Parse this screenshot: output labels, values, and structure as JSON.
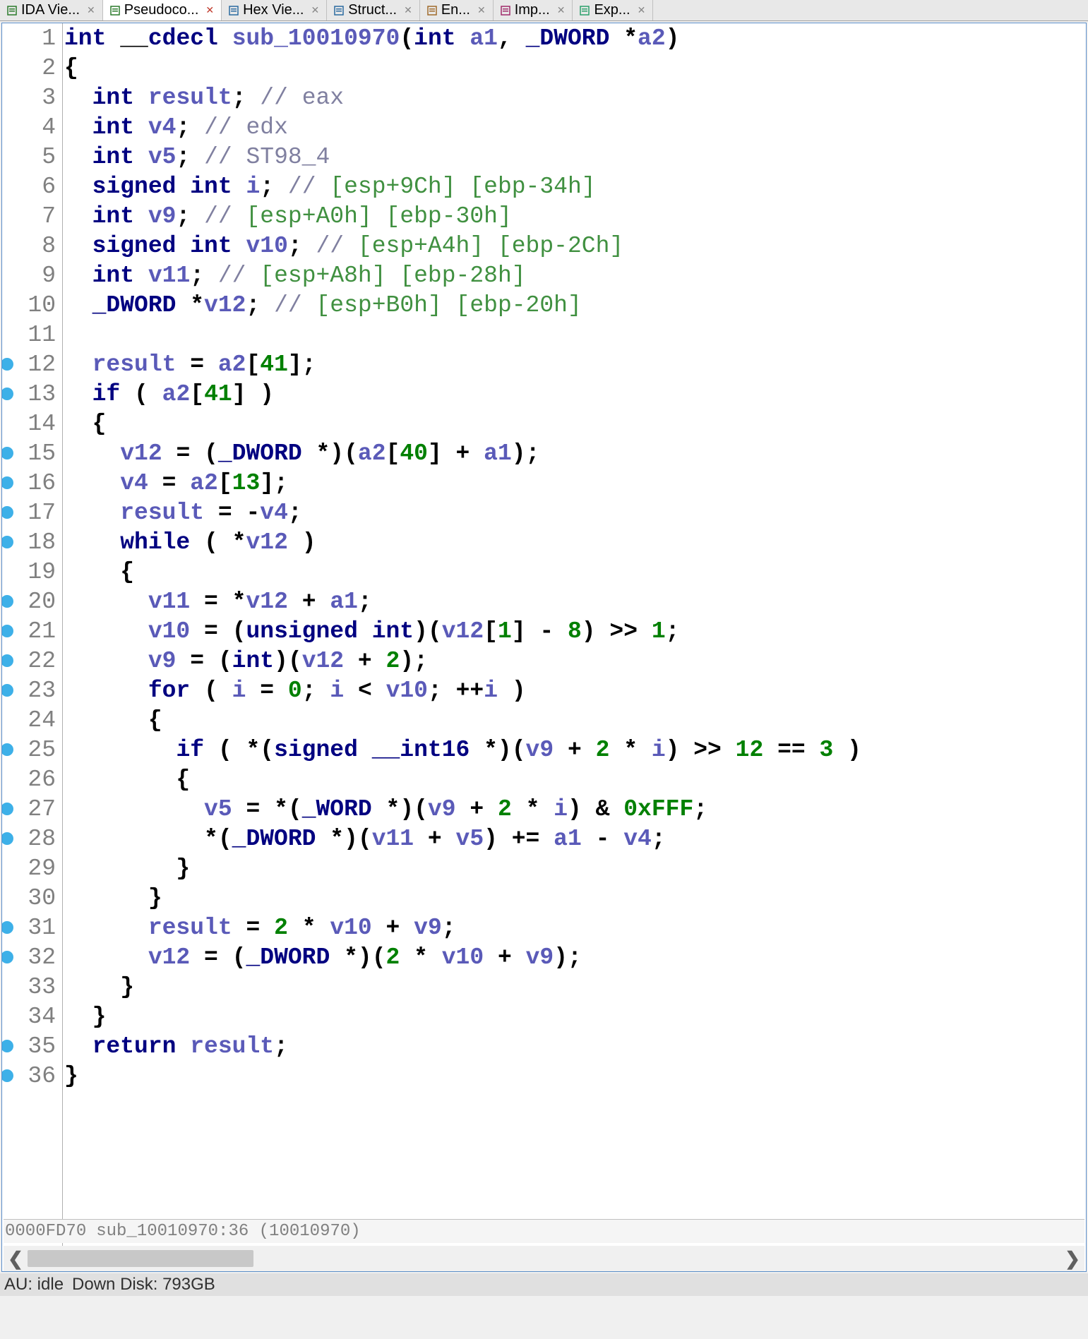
{
  "tabs": [
    {
      "label": "IDA Vie...",
      "icon": "code-icon",
      "close": "grey"
    },
    {
      "label": "Pseudoco...",
      "icon": "code-icon",
      "close": "red",
      "active": true
    },
    {
      "label": "Hex Vie...",
      "icon": "hex-icon",
      "close": "grey"
    },
    {
      "label": "Struct...",
      "icon": "struct-icon",
      "close": "grey"
    },
    {
      "label": "En...",
      "icon": "enum-icon",
      "close": "grey"
    },
    {
      "label": "Imp...",
      "icon": "import-icon",
      "close": "grey"
    },
    {
      "label": "Exp...",
      "icon": "export-icon",
      "close": "grey"
    }
  ],
  "lines": [
    {
      "n": 1,
      "bp": false,
      "tokens": [
        [
          "kw",
          "int"
        ],
        [
          "op",
          " __"
        ],
        [
          "kw",
          "cdecl"
        ],
        [
          "op",
          " "
        ],
        [
          "id",
          "sub_10010970"
        ],
        [
          "op",
          "("
        ],
        [
          "kw",
          "int"
        ],
        [
          "op",
          " "
        ],
        [
          "id",
          "a1"
        ],
        [
          "op",
          ", "
        ],
        [
          "kw",
          "_DWORD"
        ],
        [
          "op",
          " *"
        ],
        [
          "id",
          "a2"
        ],
        [
          "op",
          ")"
        ]
      ]
    },
    {
      "n": 2,
      "bp": false,
      "tokens": [
        [
          "op",
          "{"
        ]
      ]
    },
    {
      "n": 3,
      "bp": false,
      "tokens": [
        [
          "op",
          "  "
        ],
        [
          "kw",
          "int"
        ],
        [
          "op",
          " "
        ],
        [
          "id",
          "result"
        ],
        [
          "op",
          "; "
        ],
        [
          "com",
          "// eax"
        ]
      ]
    },
    {
      "n": 4,
      "bp": false,
      "tokens": [
        [
          "op",
          "  "
        ],
        [
          "kw",
          "int"
        ],
        [
          "op",
          " "
        ],
        [
          "id",
          "v4"
        ],
        [
          "op",
          "; "
        ],
        [
          "com",
          "// edx"
        ]
      ]
    },
    {
      "n": 5,
      "bp": false,
      "tokens": [
        [
          "op",
          "  "
        ],
        [
          "kw",
          "int"
        ],
        [
          "op",
          " "
        ],
        [
          "id",
          "v5"
        ],
        [
          "op",
          "; "
        ],
        [
          "com",
          "// ST98_4"
        ]
      ]
    },
    {
      "n": 6,
      "bp": false,
      "tokens": [
        [
          "op",
          "  "
        ],
        [
          "kw",
          "signed int"
        ],
        [
          "op",
          " "
        ],
        [
          "id",
          "i"
        ],
        [
          "op",
          "; "
        ],
        [
          "com",
          "// "
        ],
        [
          "comg",
          "[esp+9Ch] [ebp-34h]"
        ]
      ]
    },
    {
      "n": 7,
      "bp": false,
      "tokens": [
        [
          "op",
          "  "
        ],
        [
          "kw",
          "int"
        ],
        [
          "op",
          " "
        ],
        [
          "id",
          "v9"
        ],
        [
          "op",
          "; "
        ],
        [
          "com",
          "// "
        ],
        [
          "comg",
          "[esp+A0h] [ebp-30h]"
        ]
      ]
    },
    {
      "n": 8,
      "bp": false,
      "tokens": [
        [
          "op",
          "  "
        ],
        [
          "kw",
          "signed int"
        ],
        [
          "op",
          " "
        ],
        [
          "id",
          "v10"
        ],
        [
          "op",
          "; "
        ],
        [
          "com",
          "// "
        ],
        [
          "comg",
          "[esp+A4h] [ebp-2Ch]"
        ]
      ]
    },
    {
      "n": 9,
      "bp": false,
      "tokens": [
        [
          "op",
          "  "
        ],
        [
          "kw",
          "int"
        ],
        [
          "op",
          " "
        ],
        [
          "id",
          "v11"
        ],
        [
          "op",
          "; "
        ],
        [
          "com",
          "// "
        ],
        [
          "comg",
          "[esp+A8h] [ebp-28h]"
        ]
      ]
    },
    {
      "n": 10,
      "bp": false,
      "tokens": [
        [
          "op",
          "  "
        ],
        [
          "kw",
          "_DWORD"
        ],
        [
          "op",
          " *"
        ],
        [
          "id",
          "v12"
        ],
        [
          "op",
          "; "
        ],
        [
          "com",
          "// "
        ],
        [
          "comg",
          "[esp+B0h] [ebp-20h]"
        ]
      ]
    },
    {
      "n": 11,
      "bp": false,
      "tokens": [
        [
          "op",
          ""
        ]
      ]
    },
    {
      "n": 12,
      "bp": true,
      "tokens": [
        [
          "op",
          "  "
        ],
        [
          "id",
          "result"
        ],
        [
          "op",
          " = "
        ],
        [
          "id",
          "a2"
        ],
        [
          "op",
          "["
        ],
        [
          "num",
          "41"
        ],
        [
          "op",
          "];"
        ]
      ]
    },
    {
      "n": 13,
      "bp": true,
      "tokens": [
        [
          "op",
          "  "
        ],
        [
          "kw",
          "if"
        ],
        [
          "op",
          " ( "
        ],
        [
          "id",
          "a2"
        ],
        [
          "op",
          "["
        ],
        [
          "num",
          "41"
        ],
        [
          "op",
          "] )"
        ]
      ]
    },
    {
      "n": 14,
      "bp": false,
      "tokens": [
        [
          "op",
          "  {"
        ]
      ]
    },
    {
      "n": 15,
      "bp": true,
      "tokens": [
        [
          "op",
          "    "
        ],
        [
          "id",
          "v12"
        ],
        [
          "op",
          " = ("
        ],
        [
          "kw",
          "_DWORD"
        ],
        [
          "op",
          " *)("
        ],
        [
          "id",
          "a2"
        ],
        [
          "op",
          "["
        ],
        [
          "num",
          "40"
        ],
        [
          "op",
          "] + "
        ],
        [
          "id",
          "a1"
        ],
        [
          "op",
          ");"
        ]
      ]
    },
    {
      "n": 16,
      "bp": true,
      "tokens": [
        [
          "op",
          "    "
        ],
        [
          "id",
          "v4"
        ],
        [
          "op",
          " = "
        ],
        [
          "id",
          "a2"
        ],
        [
          "op",
          "["
        ],
        [
          "num",
          "13"
        ],
        [
          "op",
          "];"
        ]
      ]
    },
    {
      "n": 17,
      "bp": true,
      "tokens": [
        [
          "op",
          "    "
        ],
        [
          "id",
          "result"
        ],
        [
          "op",
          " = -"
        ],
        [
          "id",
          "v4"
        ],
        [
          "op",
          ";"
        ]
      ]
    },
    {
      "n": 18,
      "bp": true,
      "tokens": [
        [
          "op",
          "    "
        ],
        [
          "kw",
          "while"
        ],
        [
          "op",
          " ( *"
        ],
        [
          "id",
          "v12"
        ],
        [
          "op",
          " )"
        ]
      ]
    },
    {
      "n": 19,
      "bp": false,
      "tokens": [
        [
          "op",
          "    {"
        ]
      ]
    },
    {
      "n": 20,
      "bp": true,
      "tokens": [
        [
          "op",
          "      "
        ],
        [
          "id",
          "v11"
        ],
        [
          "op",
          " = *"
        ],
        [
          "id",
          "v12"
        ],
        [
          "op",
          " + "
        ],
        [
          "id",
          "a1"
        ],
        [
          "op",
          ";"
        ]
      ]
    },
    {
      "n": 21,
      "bp": true,
      "tokens": [
        [
          "op",
          "      "
        ],
        [
          "id",
          "v10"
        ],
        [
          "op",
          " = ("
        ],
        [
          "kw",
          "unsigned int"
        ],
        [
          "op",
          ")("
        ],
        [
          "id",
          "v12"
        ],
        [
          "op",
          "["
        ],
        [
          "num",
          "1"
        ],
        [
          "op",
          "] - "
        ],
        [
          "num",
          "8"
        ],
        [
          "op",
          ") >> "
        ],
        [
          "num",
          "1"
        ],
        [
          "op",
          ";"
        ]
      ]
    },
    {
      "n": 22,
      "bp": true,
      "tokens": [
        [
          "op",
          "      "
        ],
        [
          "id",
          "v9"
        ],
        [
          "op",
          " = ("
        ],
        [
          "kw",
          "int"
        ],
        [
          "op",
          ")("
        ],
        [
          "id",
          "v12"
        ],
        [
          "op",
          " + "
        ],
        [
          "num",
          "2"
        ],
        [
          "op",
          ");"
        ]
      ]
    },
    {
      "n": 23,
      "bp": true,
      "tokens": [
        [
          "op",
          "      "
        ],
        [
          "kw",
          "for"
        ],
        [
          "op",
          " ( "
        ],
        [
          "id",
          "i"
        ],
        [
          "op",
          " = "
        ],
        [
          "num",
          "0"
        ],
        [
          "op",
          "; "
        ],
        [
          "id",
          "i"
        ],
        [
          "op",
          " < "
        ],
        [
          "id",
          "v10"
        ],
        [
          "op",
          "; ++"
        ],
        [
          "id",
          "i"
        ],
        [
          "op",
          " )"
        ]
      ]
    },
    {
      "n": 24,
      "bp": false,
      "tokens": [
        [
          "op",
          "      {"
        ]
      ]
    },
    {
      "n": 25,
      "bp": true,
      "tokens": [
        [
          "op",
          "        "
        ],
        [
          "kw",
          "if"
        ],
        [
          "op",
          " ( *("
        ],
        [
          "kw",
          "signed __int16"
        ],
        [
          "op",
          " *)("
        ],
        [
          "id",
          "v9"
        ],
        [
          "op",
          " + "
        ],
        [
          "num",
          "2"
        ],
        [
          "op",
          " * "
        ],
        [
          "id",
          "i"
        ],
        [
          "op",
          ") >> "
        ],
        [
          "num",
          "12"
        ],
        [
          "op",
          " == "
        ],
        [
          "num",
          "3"
        ],
        [
          "op",
          " )"
        ]
      ]
    },
    {
      "n": 26,
      "bp": false,
      "tokens": [
        [
          "op",
          "        {"
        ]
      ]
    },
    {
      "n": 27,
      "bp": true,
      "tokens": [
        [
          "op",
          "          "
        ],
        [
          "id",
          "v5"
        ],
        [
          "op",
          " = *("
        ],
        [
          "kw",
          "_WORD"
        ],
        [
          "op",
          " *)("
        ],
        [
          "id",
          "v9"
        ],
        [
          "op",
          " + "
        ],
        [
          "num",
          "2"
        ],
        [
          "op",
          " * "
        ],
        [
          "id",
          "i"
        ],
        [
          "op",
          ") & "
        ],
        [
          "num",
          "0xFFF"
        ],
        [
          "op",
          ";"
        ]
      ]
    },
    {
      "n": 28,
      "bp": true,
      "tokens": [
        [
          "op",
          "          *("
        ],
        [
          "kw",
          "_DWORD"
        ],
        [
          "op",
          " *)("
        ],
        [
          "id",
          "v11"
        ],
        [
          "op",
          " + "
        ],
        [
          "id",
          "v5"
        ],
        [
          "op",
          ") += "
        ],
        [
          "id",
          "a1"
        ],
        [
          "op",
          " - "
        ],
        [
          "id",
          "v4"
        ],
        [
          "op",
          ";"
        ]
      ]
    },
    {
      "n": 29,
      "bp": false,
      "tokens": [
        [
          "op",
          "        }"
        ]
      ]
    },
    {
      "n": 30,
      "bp": false,
      "tokens": [
        [
          "op",
          "      }"
        ]
      ]
    },
    {
      "n": 31,
      "bp": true,
      "tokens": [
        [
          "op",
          "      "
        ],
        [
          "id",
          "result"
        ],
        [
          "op",
          " = "
        ],
        [
          "num",
          "2"
        ],
        [
          "op",
          " * "
        ],
        [
          "id",
          "v10"
        ],
        [
          "op",
          " + "
        ],
        [
          "id",
          "v9"
        ],
        [
          "op",
          ";"
        ]
      ]
    },
    {
      "n": 32,
      "bp": true,
      "tokens": [
        [
          "op",
          "      "
        ],
        [
          "id",
          "v12"
        ],
        [
          "op",
          " = ("
        ],
        [
          "kw",
          "_DWORD"
        ],
        [
          "op",
          " *)("
        ],
        [
          "num",
          "2"
        ],
        [
          "op",
          " * "
        ],
        [
          "id",
          "v10"
        ],
        [
          "op",
          " + "
        ],
        [
          "id",
          "v9"
        ],
        [
          "op",
          ");"
        ]
      ]
    },
    {
      "n": 33,
      "bp": false,
      "tokens": [
        [
          "op",
          "    }"
        ]
      ]
    },
    {
      "n": 34,
      "bp": false,
      "tokens": [
        [
          "op",
          "  }"
        ]
      ]
    },
    {
      "n": 35,
      "bp": true,
      "tokens": [
        [
          "op",
          "  "
        ],
        [
          "kw",
          "return"
        ],
        [
          "op",
          " "
        ],
        [
          "id",
          "result"
        ],
        [
          "op",
          ";"
        ]
      ]
    },
    {
      "n": 36,
      "bp": true,
      "tokens": [
        [
          "op",
          "}"
        ]
      ]
    }
  ],
  "nav": {
    "address": "0000FD70",
    "location": "sub_10010970:36 (10010970)"
  },
  "status": {
    "au": "AU:  idle",
    "disk": "Down Disk: 793GB"
  }
}
